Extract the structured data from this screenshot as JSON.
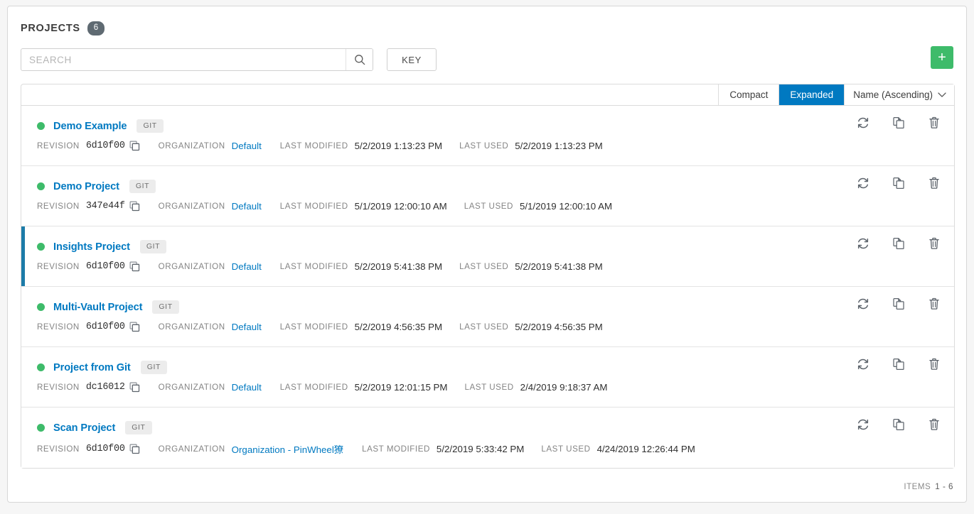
{
  "header": {
    "title": "PROJECTS",
    "count": "6"
  },
  "toolbar": {
    "search_placeholder": "SEARCH",
    "search_value": "",
    "search_icon": "search-icon",
    "key_label": "KEY",
    "add_label": "+",
    "add_color": "#3ebb6a"
  },
  "list_controls": {
    "compact_label": "Compact",
    "expanded_label": "Expanded",
    "active_view": "Expanded",
    "sort_label": "Name (Ascending)",
    "caret_icon": "chevron-down-icon",
    "active_color": "#0079c1"
  },
  "labels": {
    "revision": "REVISION",
    "organization": "ORGANIZATION",
    "last_modified": "LAST MODIFIED",
    "last_used": "LAST USED"
  },
  "actions": {
    "sync_icon": "sync-icon",
    "copy_icon": "copy-icon",
    "delete_icon": "trash-icon",
    "clipboard_icon": "clipboard-copy-icon"
  },
  "rows": [
    {
      "name": "Demo Example",
      "scm": "GIT",
      "status_color": "#3ebb6a",
      "selected": false,
      "revision": "6d10f00",
      "organization": "Default",
      "last_modified": "5/2/2019 1:13:23 PM",
      "last_used": "5/2/2019 1:13:23 PM"
    },
    {
      "name": "Demo Project",
      "scm": "GIT",
      "status_color": "#3ebb6a",
      "selected": false,
      "revision": "347e44f",
      "organization": "Default",
      "last_modified": "5/1/2019 12:00:10 AM",
      "last_used": "5/1/2019 12:00:10 AM"
    },
    {
      "name": "Insights Project",
      "scm": "GIT",
      "status_color": "#3ebb6a",
      "selected": true,
      "revision": "6d10f00",
      "organization": "Default",
      "last_modified": "5/2/2019 5:41:38 PM",
      "last_used": "5/2/2019 5:41:38 PM"
    },
    {
      "name": "Multi-Vault Project",
      "scm": "GIT",
      "status_color": "#3ebb6a",
      "selected": false,
      "revision": "6d10f00",
      "organization": "Default",
      "last_modified": "5/2/2019 4:56:35 PM",
      "last_used": "5/2/2019 4:56:35 PM"
    },
    {
      "name": "Project from Git",
      "scm": "GIT",
      "status_color": "#3ebb6a",
      "selected": false,
      "revision": "dc16012",
      "organization": "Default",
      "last_modified": "5/2/2019 12:01:15 PM",
      "last_used": "2/4/2019 9:18:37 AM"
    },
    {
      "name": "Scan Project",
      "scm": "GIT",
      "status_color": "#3ebb6a",
      "selected": false,
      "revision": "6d10f00",
      "organization": "Organization - PinWheel獠",
      "last_modified": "5/2/2019 5:33:42 PM",
      "last_used": "4/24/2019 12:26:44 PM"
    }
  ],
  "footer": {
    "items_label": "ITEMS",
    "items_range": "1 - 6"
  }
}
